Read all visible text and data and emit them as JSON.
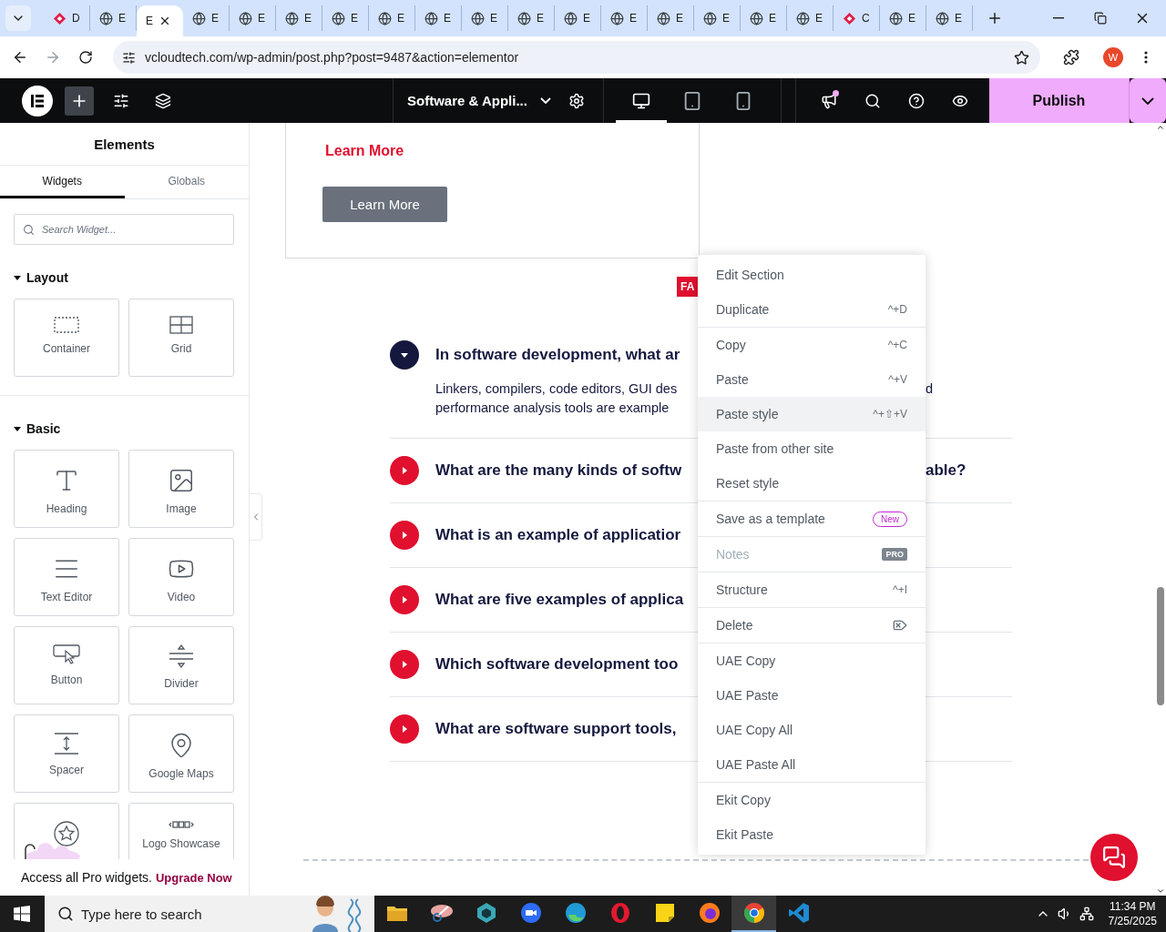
{
  "browser": {
    "tabs": [
      {
        "label": "D",
        "kind": "pink",
        "selected": false
      },
      {
        "label": "E",
        "kind": "globe",
        "selected": false
      },
      {
        "label": "E",
        "kind": "none",
        "selected": true
      },
      {
        "label": "E",
        "kind": "globe",
        "selected": false
      },
      {
        "label": "E",
        "kind": "globe",
        "selected": false
      },
      {
        "label": "E",
        "kind": "globe",
        "selected": false
      },
      {
        "label": "E",
        "kind": "globe",
        "selected": false
      },
      {
        "label": "E",
        "kind": "globe",
        "selected": false
      },
      {
        "label": "E",
        "kind": "globe",
        "selected": false
      },
      {
        "label": "E",
        "kind": "globe",
        "selected": false
      },
      {
        "label": "E",
        "kind": "globe",
        "selected": false
      },
      {
        "label": "E",
        "kind": "globe",
        "selected": false
      },
      {
        "label": "E",
        "kind": "globe",
        "selected": false
      },
      {
        "label": "E",
        "kind": "globe",
        "selected": false
      },
      {
        "label": "E",
        "kind": "globe",
        "selected": false
      },
      {
        "label": "E",
        "kind": "globe",
        "selected": false
      },
      {
        "label": "E",
        "kind": "globe",
        "selected": false
      },
      {
        "label": "C",
        "kind": "pink",
        "selected": false
      },
      {
        "label": "E",
        "kind": "globe",
        "selected": false
      },
      {
        "label": "E",
        "kind": "globe",
        "selected": false
      }
    ],
    "url": "vcloudtech.com/wp-admin/post.php?post=9487&action=elementor",
    "profile": "W"
  },
  "editor_bar": {
    "page_title": "Software & Appli...",
    "devices": [
      {
        "kind": "desktop",
        "selected": true
      },
      {
        "kind": "tablet",
        "selected": false
      },
      {
        "kind": "mobile",
        "selected": false
      }
    ],
    "publish": "Publish"
  },
  "panel": {
    "title": "Elements",
    "tabs": [
      {
        "label": "Widgets",
        "selected": true
      },
      {
        "label": "Globals",
        "selected": false
      }
    ],
    "search": {
      "placeholder": "Search Widget..."
    },
    "sections": [
      {
        "title": "Layout",
        "expanded": true,
        "widgets": [
          {
            "label": "Container",
            "kind": "container"
          },
          {
            "label": "Grid",
            "kind": "grid"
          }
        ]
      },
      {
        "title": "Basic",
        "expanded": true,
        "widgets": [
          {
            "label": "Heading",
            "kind": "heading"
          },
          {
            "label": "Image",
            "kind": "image"
          },
          {
            "label": "Text Editor",
            "kind": "text-editor"
          },
          {
            "label": "Video",
            "kind": "video"
          },
          {
            "label": "Button",
            "kind": "button"
          },
          {
            "label": "Divider",
            "kind": "divider"
          },
          {
            "label": "Spacer",
            "kind": "spacer"
          },
          {
            "label": "Google Maps",
            "kind": "maps"
          },
          {
            "kind": "rating"
          },
          {
            "label": "Logo Showcase",
            "kind": "logos"
          }
        ]
      }
    ],
    "promo": {
      "text": "Access all Pro widgets.",
      "link": "Upgrade Now"
    }
  },
  "canvas": {
    "card_link": "Learn More",
    "card_button": "Learn More",
    "badge": "FA",
    "faq": [
      {
        "question": "In software development, what ar",
        "answer": "Linkers, compilers, code editors, GUI des",
        "answer_tail": "d",
        "answer_line_2": "performance analysis tools are example",
        "expanded": true
      },
      {
        "question": "What are the many kinds of softw",
        "question_tail": "able?",
        "expanded": false
      },
      {
        "question": "What is an example of applicatior",
        "expanded": false
      },
      {
        "question": "What are five examples of applica",
        "expanded": false
      },
      {
        "question": "Which software development too",
        "expanded": false
      },
      {
        "question": "What are software support tools,",
        "expanded": false
      }
    ]
  },
  "context_menu": {
    "groups": [
      [
        {
          "label": "Edit Section",
          "highlighted": false,
          "disabled": false
        },
        {
          "label": "Duplicate",
          "shortcut": "^+D",
          "highlighted": false,
          "disabled": false
        }
      ],
      [
        {
          "label": "Copy",
          "shortcut": "^+C",
          "highlighted": false,
          "disabled": false
        },
        {
          "label": "Paste",
          "shortcut": "^+V",
          "highlighted": false,
          "disabled": false
        },
        {
          "label": "Paste style",
          "shortcut": "^+⇧+V",
          "highlighted": true,
          "disabled": false
        },
        {
          "label": "Paste from other site",
          "highlighted": false,
          "disabled": false
        },
        {
          "label": "Reset style",
          "highlighted": false,
          "disabled": false
        }
      ],
      [
        {
          "label": "Save as a template",
          "badge": "New",
          "highlighted": false,
          "disabled": false
        }
      ],
      [
        {
          "label": "Notes",
          "badge": "PRO",
          "highlighted": false,
          "disabled": true
        }
      ],
      [
        {
          "label": "Structure",
          "shortcut": "^+I",
          "highlighted": false,
          "disabled": false
        }
      ],
      [
        {
          "label": "Delete",
          "kind": "delete",
          "highlighted": false,
          "disabled": false
        }
      ],
      [
        {
          "label": "UAE Copy",
          "highlighted": false,
          "disabled": false
        },
        {
          "label": "UAE Paste",
          "highlighted": false,
          "disabled": false
        },
        {
          "label": "UAE Copy All",
          "highlighted": false,
          "disabled": false
        },
        {
          "label": "UAE Paste All",
          "highlighted": false,
          "disabled": false
        }
      ],
      [
        {
          "label": "Ekit Copy",
          "highlighted": false,
          "disabled": false
        },
        {
          "label": "Ekit Paste",
          "highlighted": false,
          "disabled": false
        }
      ]
    ]
  },
  "taskbar": {
    "search": {
      "placeholder": "Type here to search"
    },
    "apps": [
      {
        "kind": "explorer",
        "selected": false
      },
      {
        "kind": "snip",
        "selected": false
      },
      {
        "kind": "hex",
        "selected": false
      },
      {
        "kind": "zoom",
        "selected": false
      },
      {
        "kind": "edge",
        "selected": false
      },
      {
        "kind": "opera",
        "selected": false
      },
      {
        "kind": "notes",
        "selected": false
      },
      {
        "kind": "firefox",
        "selected": false
      },
      {
        "kind": "chrome",
        "selected": true
      },
      {
        "kind": "vscode",
        "selected": false
      }
    ],
    "time": "11:34 PM",
    "date": "7/25/2025"
  }
}
